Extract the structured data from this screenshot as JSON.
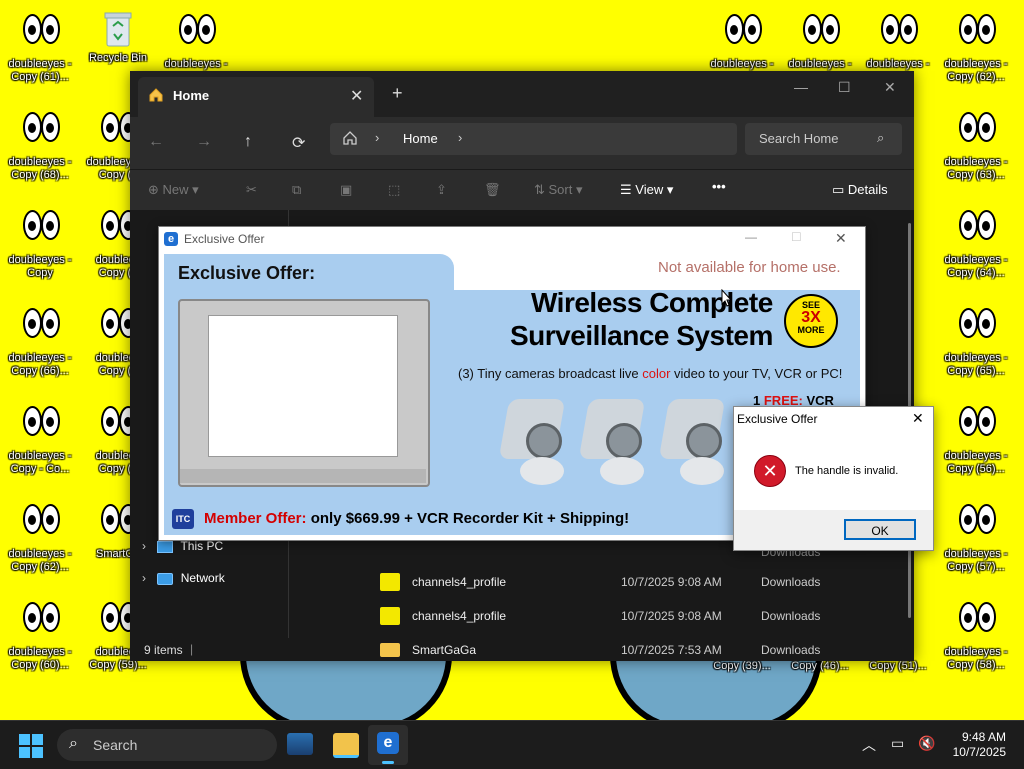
{
  "desktop": {
    "icons": [
      {
        "label": "doubleeyes -\nCopy (61)..."
      },
      {
        "label": "Recycle Bin"
      },
      {
        "label": "doubleeyes -"
      },
      {
        "label": "doubleeyes -"
      },
      {
        "label": "doubleeyes -"
      },
      {
        "label": "doubleeyes -"
      },
      {
        "label": "doubleeyes -\nCopy (62)..."
      },
      {
        "label": "doubleeyes -\nCopy (68)..."
      },
      {
        "label": "doubleeyes -\nCopy (6"
      },
      {
        "label": "doubleeyes -\nCopy (63)..."
      },
      {
        "label": "doubleeyes -\nCopy"
      },
      {
        "label": "doubleey\nCopy (7"
      },
      {
        "label": "doubleeyes -\nCopy (64)..."
      },
      {
        "label": "doubleeyes -\nCopy (66)..."
      },
      {
        "label": "doubleey\nCopy (7"
      },
      {
        "label": "doubleeyes -\nCopy (65)..."
      },
      {
        "label": "doubleeyes -\nCopy - Co..."
      },
      {
        "label": "doubleey\nCopy (7"
      },
      {
        "label": "doubleeyes -\nCopy (56)..."
      },
      {
        "label": "doubleeyes -\nCopy (62)..."
      },
      {
        "label": "SmartGa"
      },
      {
        "label": "doubleeyes -\nCopy (57)..."
      },
      {
        "label": "doubleeyes -\nCopy (60)..."
      },
      {
        "label": "doubleey\nCopy (59)..."
      },
      {
        "label": "Copy (39)..."
      },
      {
        "label": "Copy (46)..."
      },
      {
        "label": "Copy (51)..."
      },
      {
        "label": "doubleeyes -\nCopy (58)..."
      }
    ]
  },
  "explorer": {
    "tab_title": "Home",
    "address_crumb": "Home",
    "search_placeholder": "Search Home",
    "toolbar": {
      "new_label": "New",
      "sort_label": "Sort",
      "view_label": "View",
      "details_label": "Details"
    },
    "sidebar": [
      {
        "label": "This PC"
      },
      {
        "label": "Network"
      }
    ],
    "files": [
      {
        "name": "channels4_profile",
        "date": "10/7/2025 9:08 AM",
        "location": "Downloads",
        "type": "image"
      },
      {
        "name": "channels4_profile",
        "date": "10/7/2025 9:08 AM",
        "location": "Downloads",
        "type": "image"
      },
      {
        "name": "SmartGaGa",
        "date": "10/7/2025 7:53 AM",
        "location": "Downloads",
        "type": "folder"
      }
    ],
    "hidden_row_location": "Downloads",
    "status": "9 items"
  },
  "offer_window": {
    "title": "Exclusive Offer",
    "ad": {
      "heading": "Exclusive Offer:",
      "disclaimer": "Not available for home use.",
      "headline1": "Wireless Complete",
      "headline2": "Surveillance System",
      "badge_line1": "SEE",
      "badge_line2": "3X",
      "badge_line3": "MORE",
      "subtitle_pre": "(3) Tiny cameras broadcast live ",
      "subtitle_color_word": "color",
      "subtitle_post": " video to your TV, VCR or PC!",
      "free_num": "1",
      "free_label": "FREE:",
      "free_item": "VCR",
      "member_label": "Member Offer:",
      "member_text": " only $669.99 + VCR Recorder Kit + Shipping!",
      "logo_text": "ITC"
    }
  },
  "error_dialog": {
    "title": "Exclusive Offer",
    "message": "The handle is invalid.",
    "ok_label": "OK"
  },
  "taskbar": {
    "search_label": "Search",
    "time": "9:48 AM",
    "date": "10/7/2025"
  },
  "colors": {
    "desktop_bg": "#ffff00",
    "explorer_bg": "#191919",
    "ad_bg": "#a9cdef",
    "member_red": "#d40000",
    "error_red": "#d11a2a",
    "accent": "#0067c0"
  }
}
